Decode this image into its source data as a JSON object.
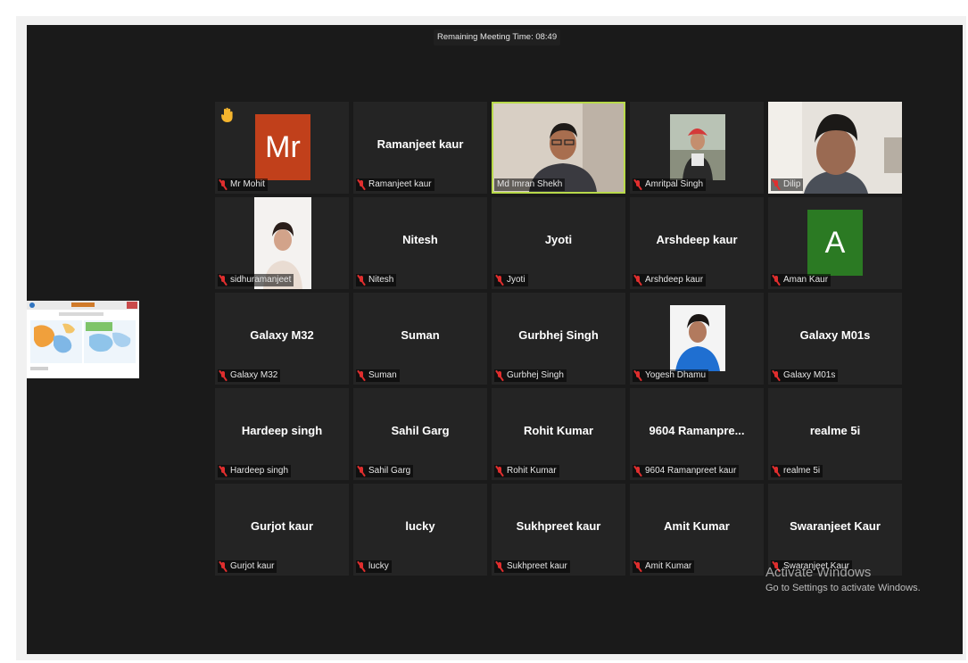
{
  "meeting": {
    "remaining_time": "Remaining Meeting Time: 08:49"
  },
  "participants": [
    {
      "display": "",
      "label": "Mr Mohit",
      "avatar_initials": "Mr",
      "avatar_color": "#c1401b",
      "hand_raised": true
    },
    {
      "display": "Ramanjeet kaur",
      "label": "Ramanjeet kaur"
    },
    {
      "display": "",
      "label": "Md Imran Shekh",
      "video": true,
      "active_speaker": true
    },
    {
      "display": "",
      "label": "Amritpal Singh",
      "photo": true
    },
    {
      "display": "",
      "label": "Dilip",
      "video": true
    },
    {
      "display": "",
      "label": "sidhuramanjeet",
      "photo": true
    },
    {
      "display": "Nitesh",
      "label": "Nitesh"
    },
    {
      "display": "Jyoti",
      "label": "Jyoti"
    },
    {
      "display": "Arshdeep kaur",
      "label": "Arshdeep kaur"
    },
    {
      "display": "",
      "label": "Aman Kaur",
      "avatar_initials": "A",
      "avatar_color": "#2b7a23"
    },
    {
      "display": "Galaxy M32",
      "label": "Galaxy M32"
    },
    {
      "display": "Suman",
      "label": "Suman"
    },
    {
      "display": "Gurbhej Singh",
      "label": "Gurbhej Singh"
    },
    {
      "display": "",
      "label": "Yogesh Dhamu",
      "photo": true
    },
    {
      "display": "Galaxy M01s",
      "label": "Galaxy M01s"
    },
    {
      "display": "Hardeep singh",
      "label": "Hardeep singh"
    },
    {
      "display": "Sahil Garg",
      "label": "Sahil Garg"
    },
    {
      "display": "Rohit Kumar",
      "label": "Rohit Kumar"
    },
    {
      "display": "9604 Ramanpre...",
      "label": "9604 Ramanpreet kaur"
    },
    {
      "display": "realme 5i",
      "label": "realme 5i"
    },
    {
      "display": "Gurjot kaur",
      "label": "Gurjot kaur"
    },
    {
      "display": "lucky",
      "label": "lucky"
    },
    {
      "display": "Sukhpreet kaur",
      "label": "Sukhpreet kaur"
    },
    {
      "display": "Amit Kumar",
      "label": "Amit Kumar"
    },
    {
      "display": "Swaranjeet Kaur",
      "label": "Swaranjeet Kaur"
    }
  ],
  "watermark": {
    "line1": "Activate Windows",
    "line2": "Go to Settings to activate Windows."
  },
  "colors": {
    "background": "#1a1a1a",
    "tile": "#242424",
    "active_border": "#b8d94a",
    "muted_mic": "#e02e2e"
  }
}
